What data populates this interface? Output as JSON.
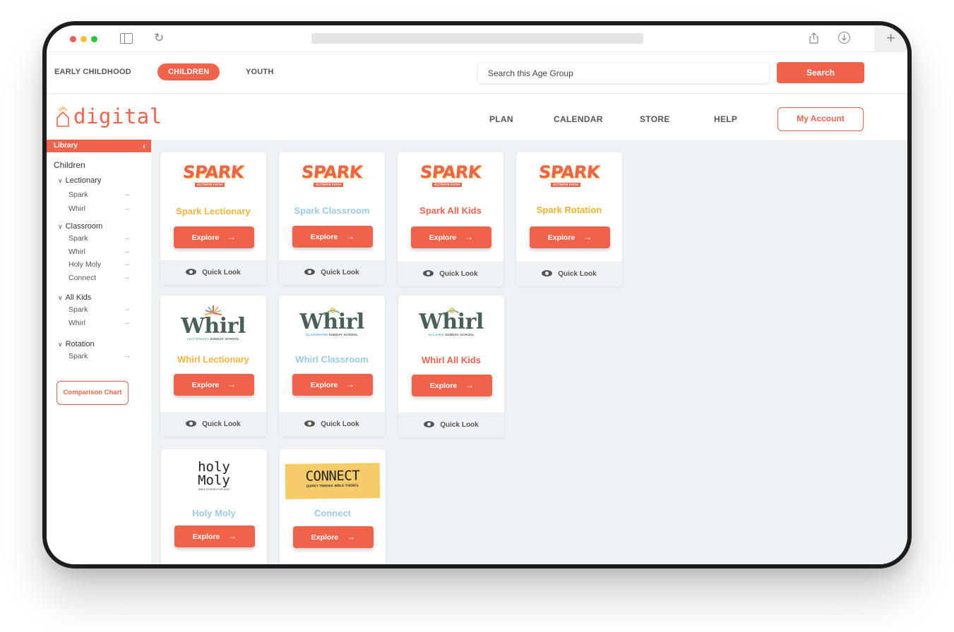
{
  "colors": {
    "accent": "#f0634a",
    "spark_lectionary": "#fbb33b",
    "spark_classroom": "#9ccbe8",
    "spark_all_kids": "#f0634a",
    "spark_rotation": "#e6b52d"
  },
  "browser": {
    "icons": [
      "sidebar-icon",
      "reload-icon",
      "share-icon",
      "download-icon",
      "plus-icon"
    ],
    "newtab": "+"
  },
  "agebar": {
    "tabs": [
      {
        "label": "EARLY CHILDHOOD",
        "active": false
      },
      {
        "label": "CHILDREN",
        "active": true
      },
      {
        "label": "YOUTH",
        "active": false
      }
    ],
    "search_placeholder": "Search this Age Group",
    "search_label": "Search"
  },
  "nav": {
    "logo": "digital",
    "links": [
      "PLAN",
      "CALENDAR",
      "STORE",
      "HELP"
    ],
    "account": "My Account"
  },
  "sidebar": {
    "header": "Library",
    "title": "Children",
    "groups": [
      {
        "label": "Lectionary",
        "items": [
          "Spark",
          "Whirl"
        ]
      },
      {
        "label": "Classroom",
        "items": [
          "Spark",
          "Whirl",
          "Holy Moly",
          "Connect"
        ]
      },
      {
        "label": "All Kids",
        "items": [
          "Spark",
          "Whirl"
        ]
      },
      {
        "label": "Rotation",
        "items": [
          "Spark"
        ]
      }
    ],
    "comparison": "Comparison Chart"
  },
  "cards": {
    "explore": "Explore",
    "quicklook": "Quick Look",
    "spark_logo": "SPARK",
    "spark_tag": "ACTIVATE FAITH",
    "whirl_logo": "Whirl",
    "items": [
      {
        "title": "Spark Lectionary"
      },
      {
        "title": "Spark Classroom"
      },
      {
        "title": "Spark All Kids"
      },
      {
        "title": "Spark Rotation"
      },
      {
        "title": "Whirl Lectionary",
        "sub_a": "LECTIONARY",
        "sub_b": " SUNDAY SCHOOL"
      },
      {
        "title": "Whirl Classroom",
        "sub_a": "CLASSROOM",
        "sub_b": " SUNDAY SCHOOL"
      },
      {
        "title": "Whirl All Kids",
        "sub_a": "ALL KIDS",
        "sub_b": " SUNDAY SCHOOL"
      },
      {
        "title": "Holy Moly",
        "logo_1": "holy",
        "logo_2": "Moly",
        "logo_sub": "BIBLE STORIES FOR KIDS"
      },
      {
        "title": "Connect",
        "logo": "CONNECT",
        "logo_sub": "QUIRKY TWEENS. BIBLE THEMES."
      }
    ]
  }
}
